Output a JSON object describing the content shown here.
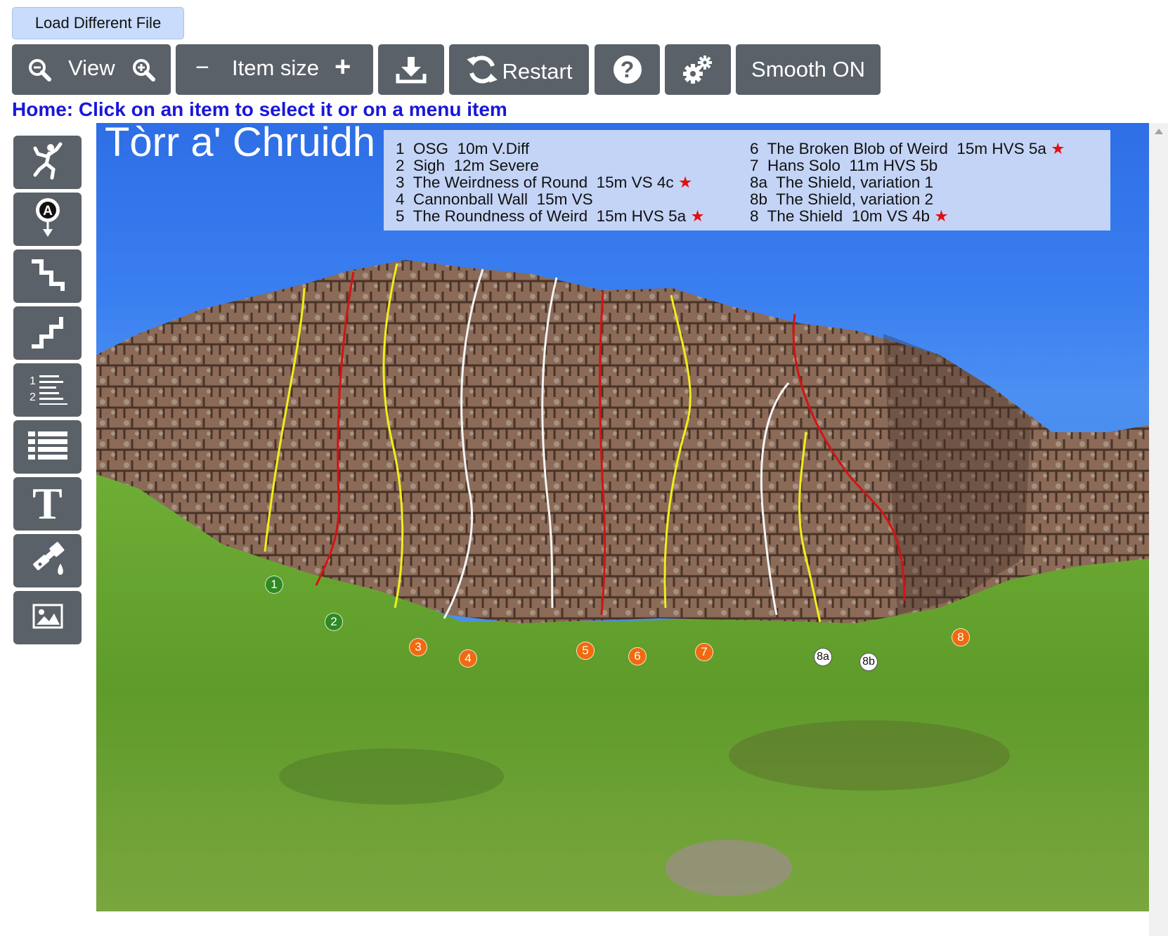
{
  "header": {
    "load_button": "Load Different File",
    "view_label": "View",
    "item_size_label": "Item size",
    "item_size_minus": "−",
    "item_size_plus": "+",
    "restart_label": "Restart",
    "help_label": "?",
    "smooth_label": "Smooth ON",
    "status": "Home: Click on an item to select it or on a menu item"
  },
  "sidebar": {
    "items": [
      {
        "icon": "climber-icon"
      },
      {
        "icon": "anchor-marker-icon"
      },
      {
        "icon": "line-down-steps-icon"
      },
      {
        "icon": "line-up-steps-icon"
      },
      {
        "icon": "numbered-list-icon"
      },
      {
        "icon": "list-icon"
      },
      {
        "icon": "text-icon",
        "glyph": "T"
      },
      {
        "icon": "paint-brush-icon"
      },
      {
        "icon": "image-icon"
      }
    ]
  },
  "topo": {
    "title": "Tòrr a' Chruidh",
    "legend_left": [
      {
        "num": "1",
        "name": "OSG",
        "length": "10m",
        "grade": "V.Diff",
        "star": ""
      },
      {
        "num": "2",
        "name": "Sigh",
        "length": "12m",
        "grade": "Severe",
        "star": ""
      },
      {
        "num": "3",
        "name": "The Weirdness of Round",
        "length": "15m",
        "grade": "VS 4c",
        "star": "★"
      },
      {
        "num": "4",
        "name": "Cannonball Wall",
        "length": "15m",
        "grade": "VS",
        "star": ""
      },
      {
        "num": "5",
        "name": "The Roundness of Weird",
        "length": "15m",
        "grade": "HVS 5a",
        "star": "★"
      }
    ],
    "legend_right": [
      {
        "num": "6",
        "name": "The Broken Blob of Weird",
        "length": "15m",
        "grade": "HVS 5a",
        "star": "★"
      },
      {
        "num": "7",
        "name": "Hans Solo",
        "length": "11m",
        "grade": "HVS 5b",
        "star": ""
      },
      {
        "num": "8a",
        "name": "The Shield, variation 1",
        "length": "",
        "grade": "",
        "star": ""
      },
      {
        "num": "8b",
        "name": "The Shield, variation 2",
        "length": "",
        "grade": "",
        "star": ""
      },
      {
        "num": "8",
        "name": "The Shield",
        "length": "10m",
        "grade": "VS 4b",
        "star": "★"
      }
    ],
    "markers": [
      {
        "label": "1",
        "color": "green"
      },
      {
        "label": "2",
        "color": "green"
      },
      {
        "label": "3",
        "color": "orange"
      },
      {
        "label": "4",
        "color": "orange"
      },
      {
        "label": "5",
        "color": "orange"
      },
      {
        "label": "6",
        "color": "orange"
      },
      {
        "label": "7",
        "color": "orange"
      },
      {
        "label": "8a",
        "color": "white"
      },
      {
        "label": "8b",
        "color": "white"
      },
      {
        "label": "8",
        "color": "orange"
      }
    ],
    "route_colors": {
      "yellow": "#f2ee1a",
      "red": "#d21414",
      "white": "#f4f4f4"
    }
  },
  "colors": {
    "button_bg": "#5a6168",
    "load_button_bg": "#c9dcfb",
    "status_text": "#1a16d8",
    "sky": "#3a7ff0",
    "legend_bg": "#c4d4f6",
    "marker_green": "#2e8a22",
    "marker_orange": "#f06a10"
  }
}
